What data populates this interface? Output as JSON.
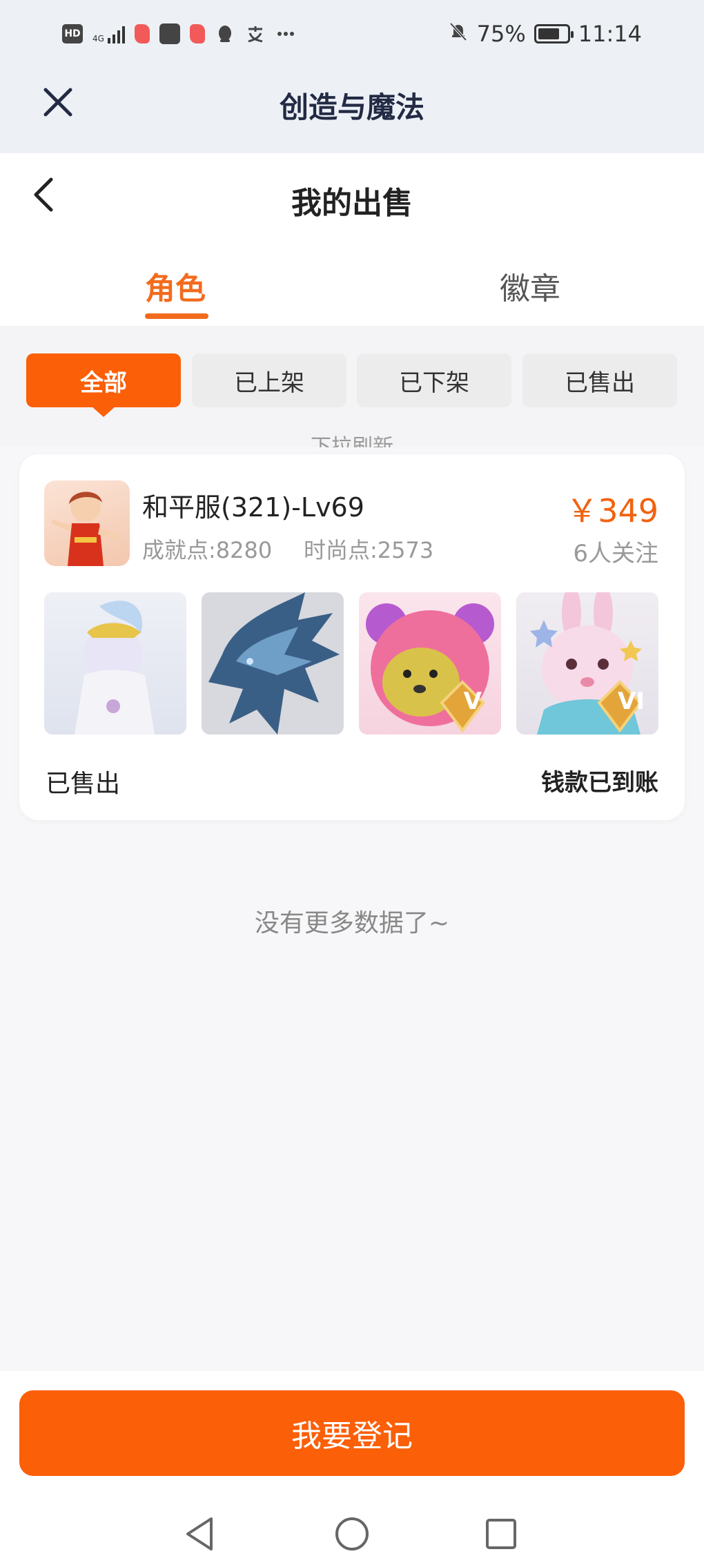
{
  "status_bar": {
    "network": "4G",
    "battery": "75%",
    "battery_level": 0.75,
    "time": "11:14",
    "icons": [
      "hd-icon",
      "signal-icon",
      "red-app-icon",
      "shopping-bag-icon",
      "red-app-icon",
      "penguin-icon",
      "chat-icon",
      "more-icon",
      "bell-off-icon",
      "battery-icon"
    ]
  },
  "app_bar": {
    "title": "创造与魔法"
  },
  "page": {
    "title": "我的出售"
  },
  "tabs": [
    {
      "label": "角色",
      "active": true
    },
    {
      "label": "徽章",
      "active": false
    }
  ],
  "filters": [
    {
      "label": "全部",
      "active": true
    },
    {
      "label": "已上架",
      "active": false
    },
    {
      "label": "已下架",
      "active": false
    },
    {
      "label": "已售出",
      "active": false
    }
  ],
  "pull_hint": "下拉刷新",
  "listing": {
    "name": "和平服(321)-Lv69",
    "achievement": "成就点:8280",
    "fashion": "时尚点:2573",
    "price": "￥349",
    "followers": "6人关注",
    "status": "已售出",
    "payment": "钱款已到账",
    "items": [
      {
        "name": "moon-maiden",
        "badge": ""
      },
      {
        "name": "ice-dragon",
        "badge": ""
      },
      {
        "name": "pink-bear",
        "badge": "V"
      },
      {
        "name": "pink-rabbit",
        "badge": "VI"
      }
    ]
  },
  "empty_text": "没有更多数据了~",
  "cta_label": "我要登记",
  "colors": {
    "accent": "#fb5f08",
    "price": "#f2620e",
    "tab_active": "#f26b1d"
  }
}
